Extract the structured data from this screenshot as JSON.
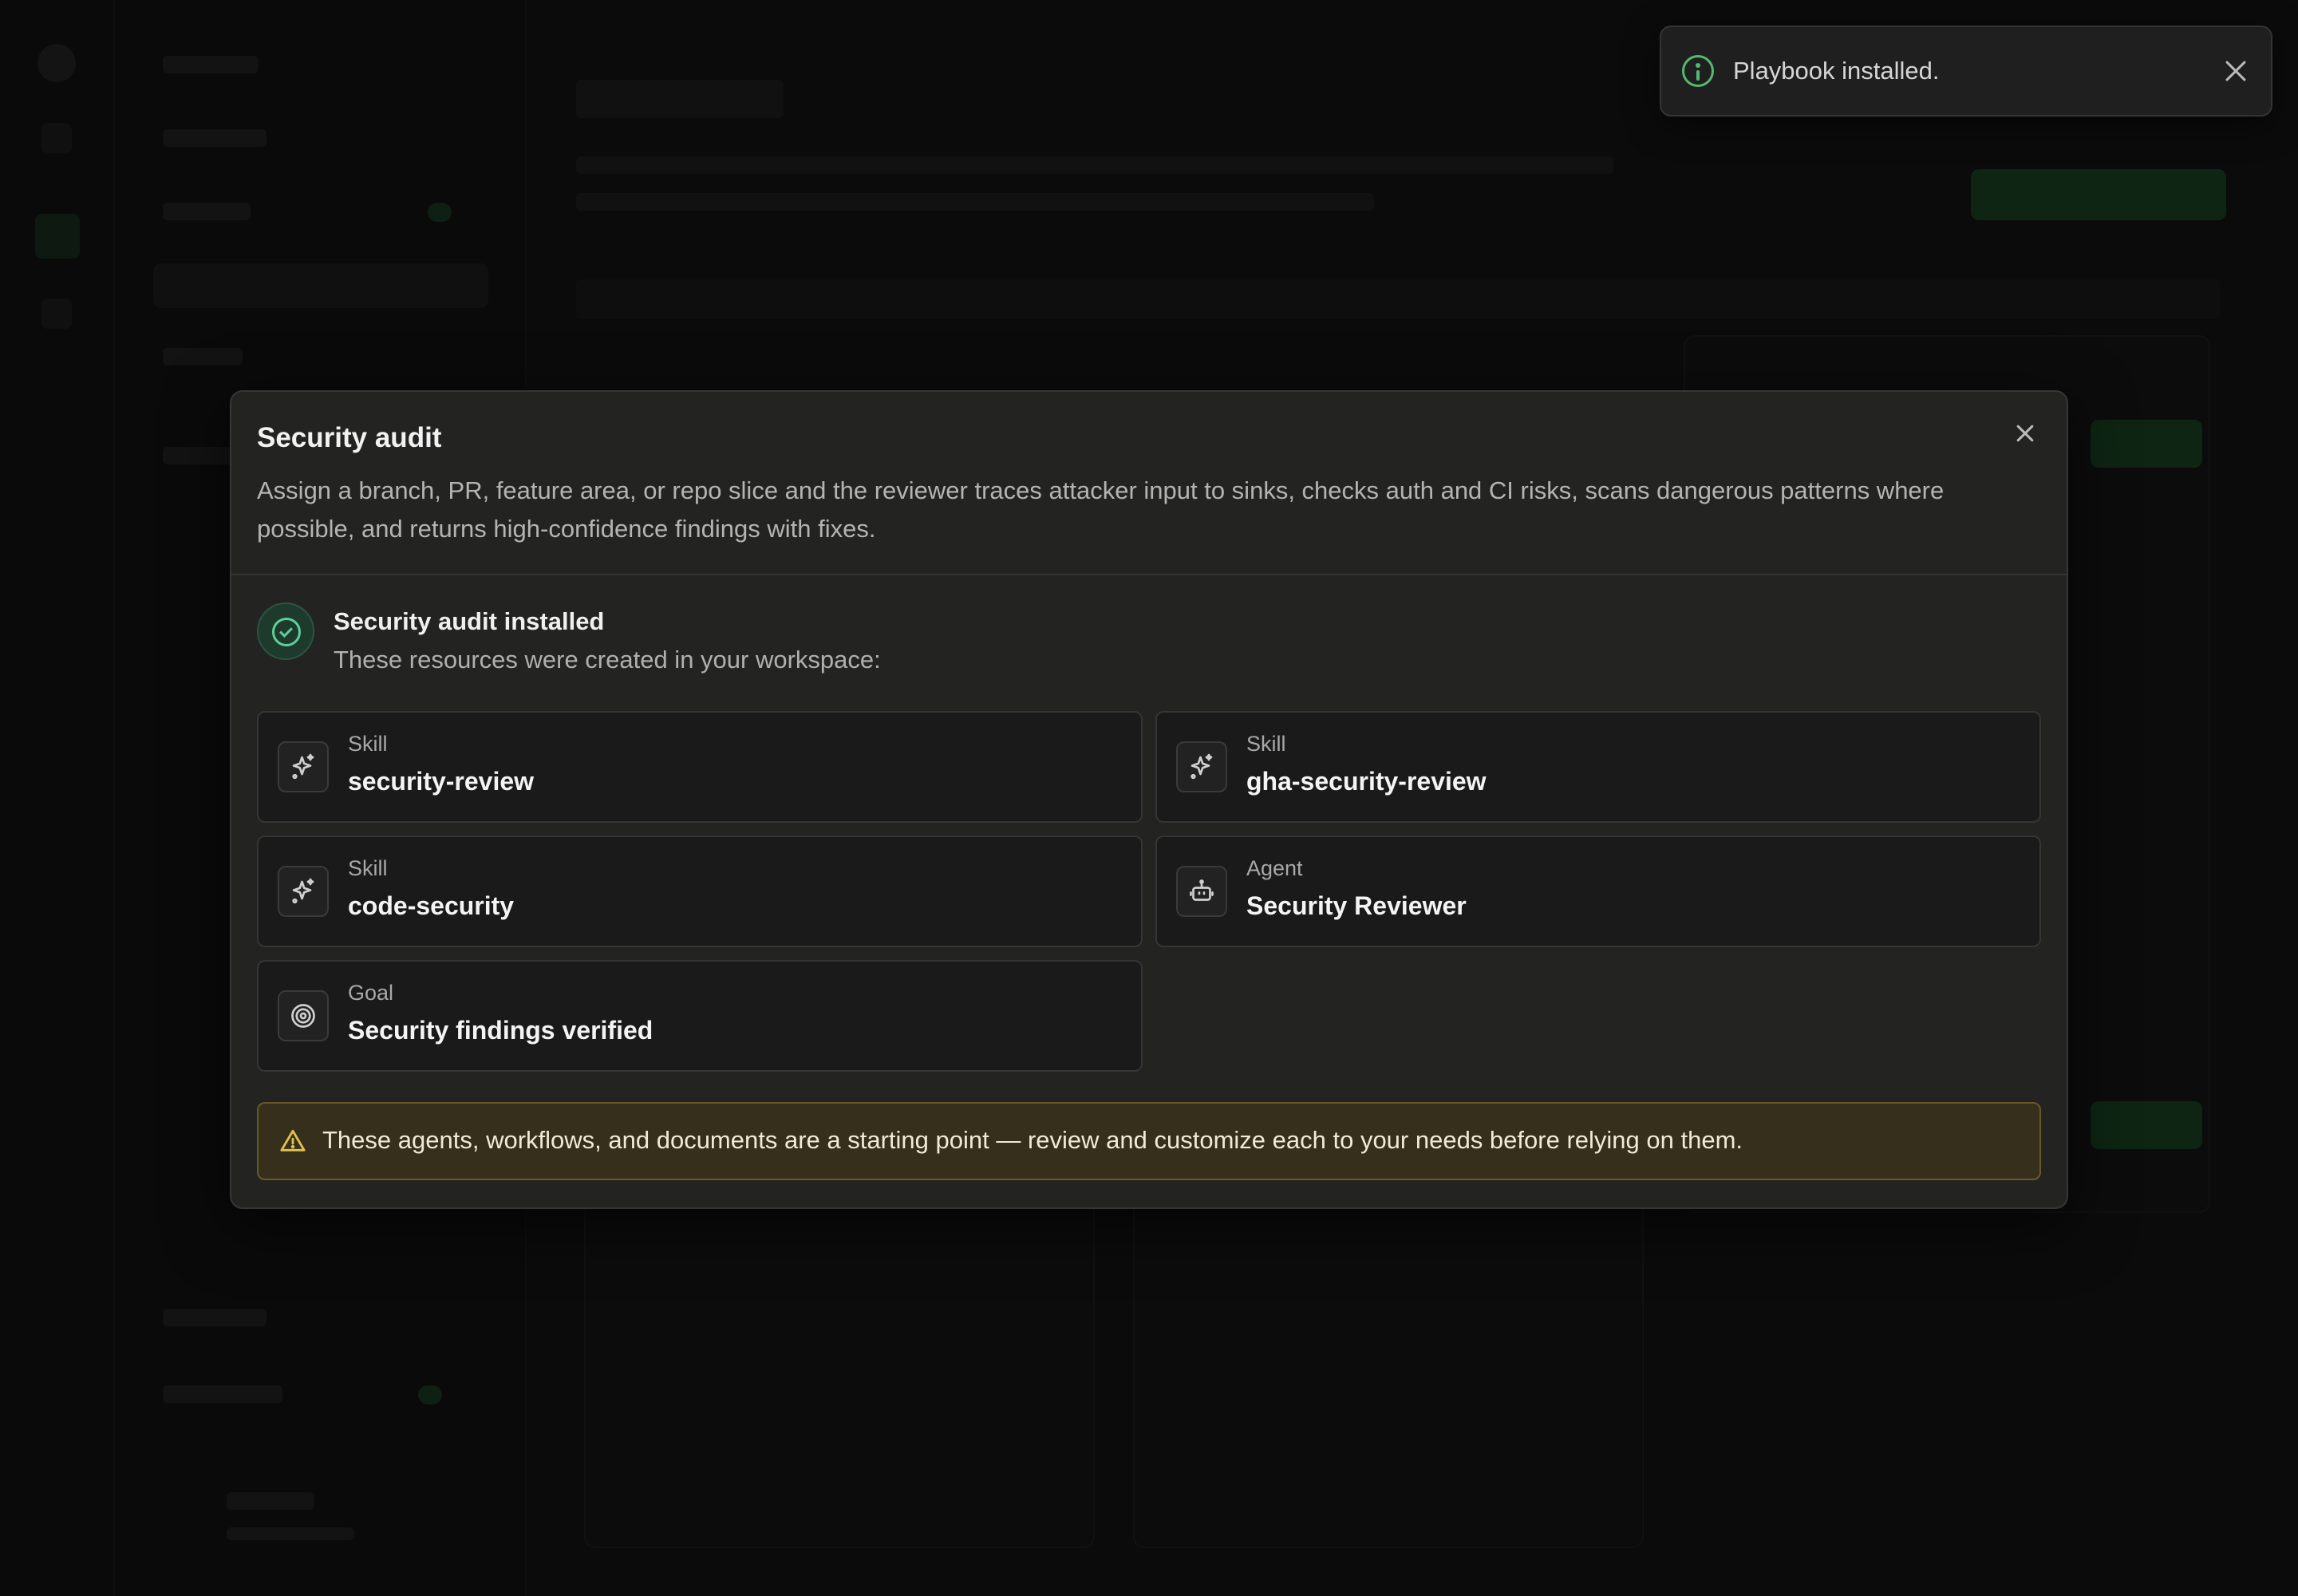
{
  "toast": {
    "message": "Playbook installed.",
    "icon": "info-icon",
    "accent": "#54b96e"
  },
  "modal": {
    "title": "Security audit",
    "description": "Assign a branch, PR, feature area, or repo slice and the reviewer traces attacker input to sinks, checks auth and CI risks, scans dangerous patterns where possible, and returns high-confidence findings with fixes.",
    "success": {
      "title": "Security audit installed",
      "subtitle": "These resources were created in your workspace:"
    },
    "resources": [
      {
        "type": "Skill",
        "name": "security-review",
        "icon": "sparkle-icon"
      },
      {
        "type": "Skill",
        "name": "gha-security-review",
        "icon": "sparkle-icon"
      },
      {
        "type": "Skill",
        "name": "code-security",
        "icon": "sparkle-icon"
      },
      {
        "type": "Agent",
        "name": "Security Reviewer",
        "icon": "robot-icon"
      },
      {
        "type": "Goal",
        "name": "Security findings verified",
        "icon": "target-icon"
      }
    ],
    "warning": "These agents, workflows, and documents are a starting point — review and customize each to your needs before relying on them."
  },
  "colors": {
    "success": "#5fcf9a",
    "warning_border": "#685a26",
    "warning_icon": "#e3c14a"
  }
}
